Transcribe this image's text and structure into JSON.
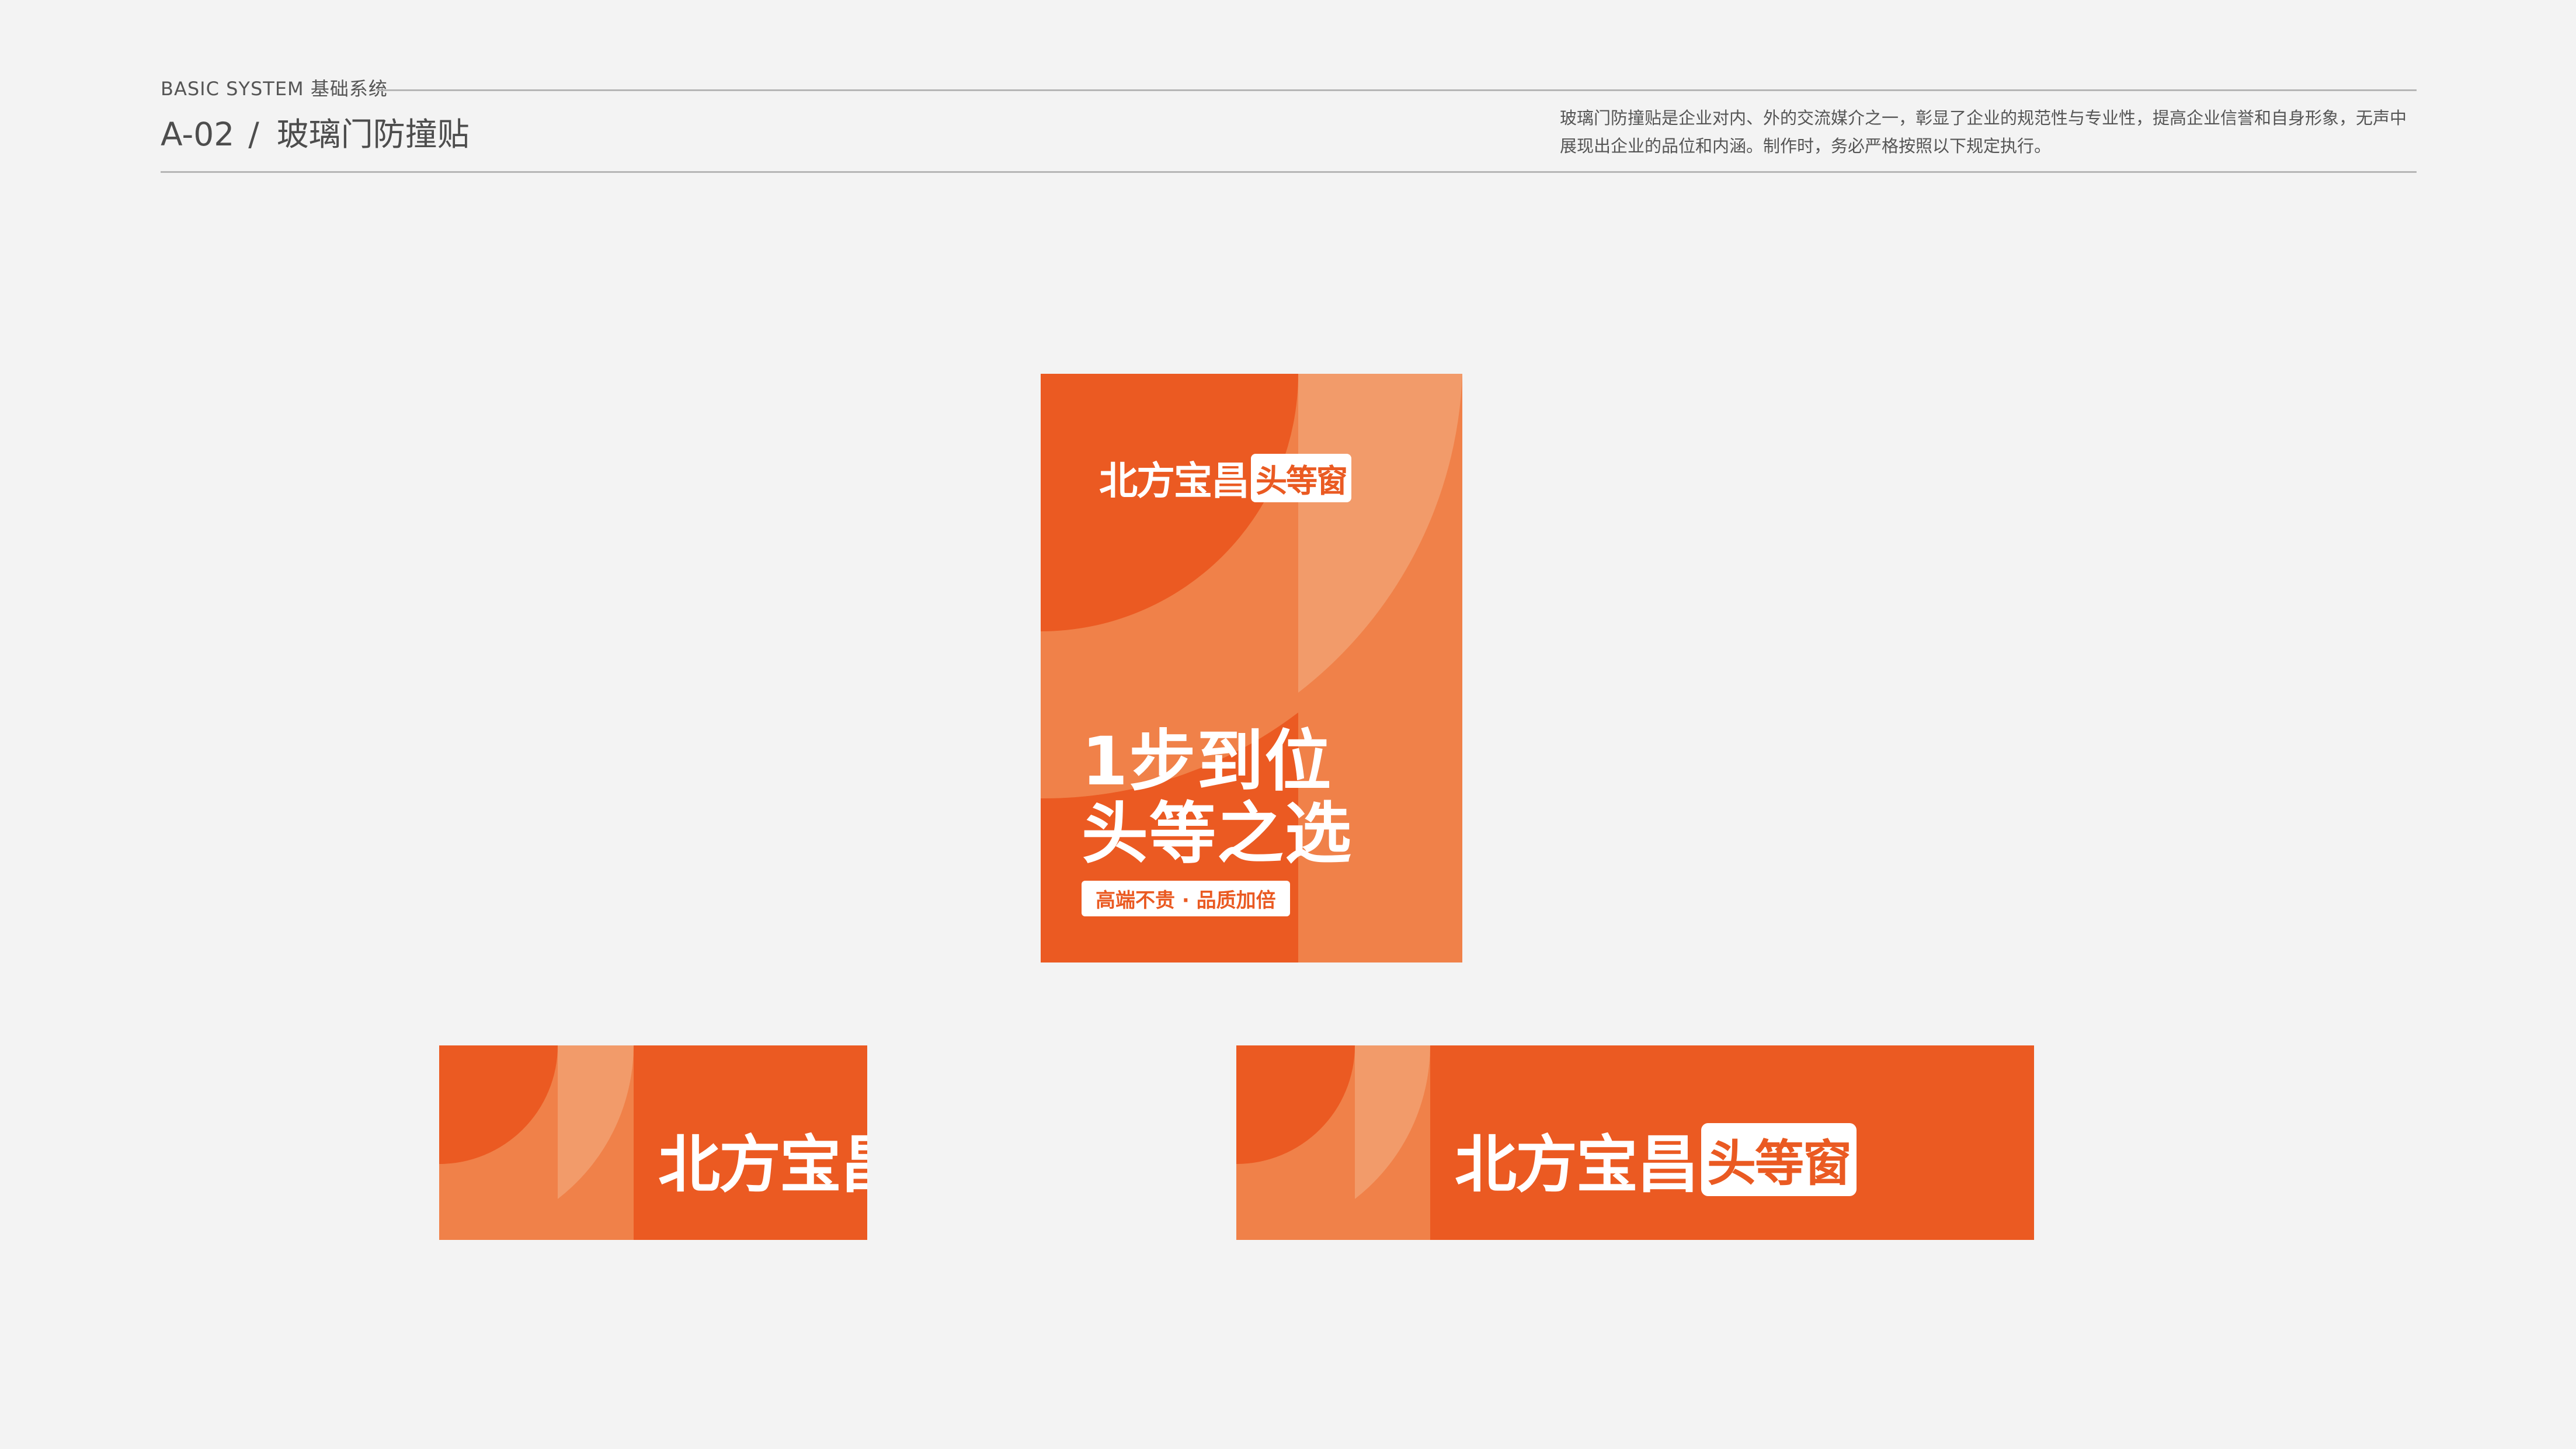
{
  "header": {
    "brand_label": "BASIC SYSTEM 基础系统",
    "section_code": "A-02",
    "section_separator": "/",
    "section_title": "玻璃门防撞贴",
    "description": "玻璃门防撞贴是企业对内、外的交流媒介之一，彰显了企业的规范性与专业性，提高企业信誉和自身形象，无声中展现出企业的品位和内涵。制作时，务必严格按照以下规定执行。"
  },
  "logo": {
    "main_text": "北方宝昌",
    "badge_text": "头等窗"
  },
  "poster": {
    "slogan_line1": "1步到位",
    "slogan_line2": "头等之选",
    "tagline": "高端不贵 · 品质加倍"
  },
  "colors": {
    "background": "#f3f3f3",
    "brand_orange": "#ea5a22",
    "light_orange": "#f08149",
    "pale_orange": "#f29b6a",
    "rule": "#b5b5b5"
  }
}
